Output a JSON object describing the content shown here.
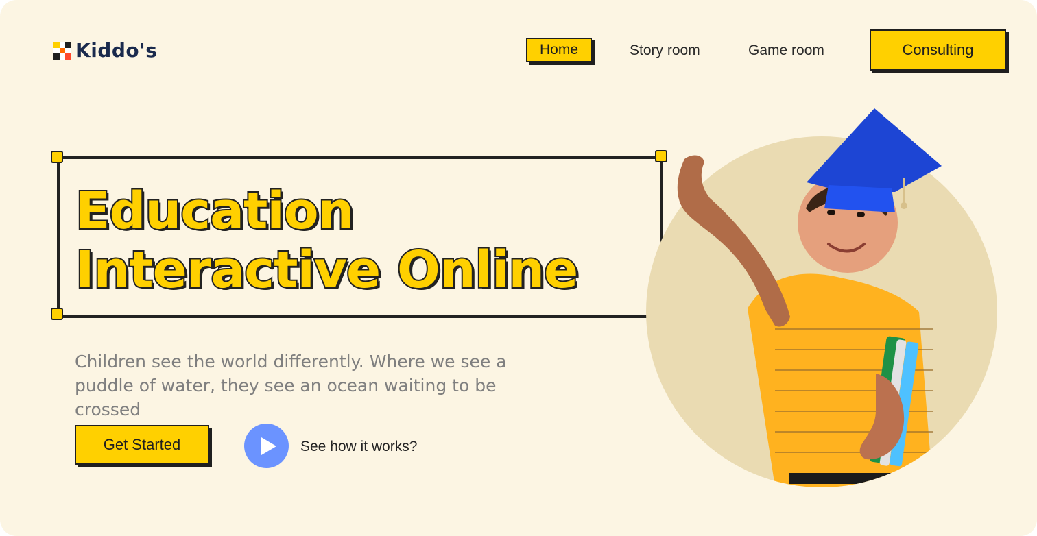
{
  "brand": {
    "name": "Kiddo's",
    "logo_icon": "pixel-grid-logo-icon"
  },
  "nav": {
    "items": [
      {
        "label": "Home"
      },
      {
        "label": "Story room"
      },
      {
        "label": "Game room"
      }
    ],
    "consulting_label": "Consulting"
  },
  "hero": {
    "title_line_1": "Education",
    "title_line_2": "Interactive Online",
    "subtitle": "Children see the world differently. Where we see a puddle of water, they see an ocean waiting to be crossed",
    "cta_primary": "Get Started",
    "cta_secondary": "See how it works?"
  },
  "colors": {
    "background": "#fcf5e3",
    "accent_yellow": "#ffd000",
    "play_blue": "#6b93ff",
    "outline": "#222222",
    "subtitle_gray": "#7f7f7f",
    "circle_tan": "#eadbb2"
  },
  "icons": {
    "play": "play-icon",
    "logo": "pixel-grid-logo-icon"
  }
}
